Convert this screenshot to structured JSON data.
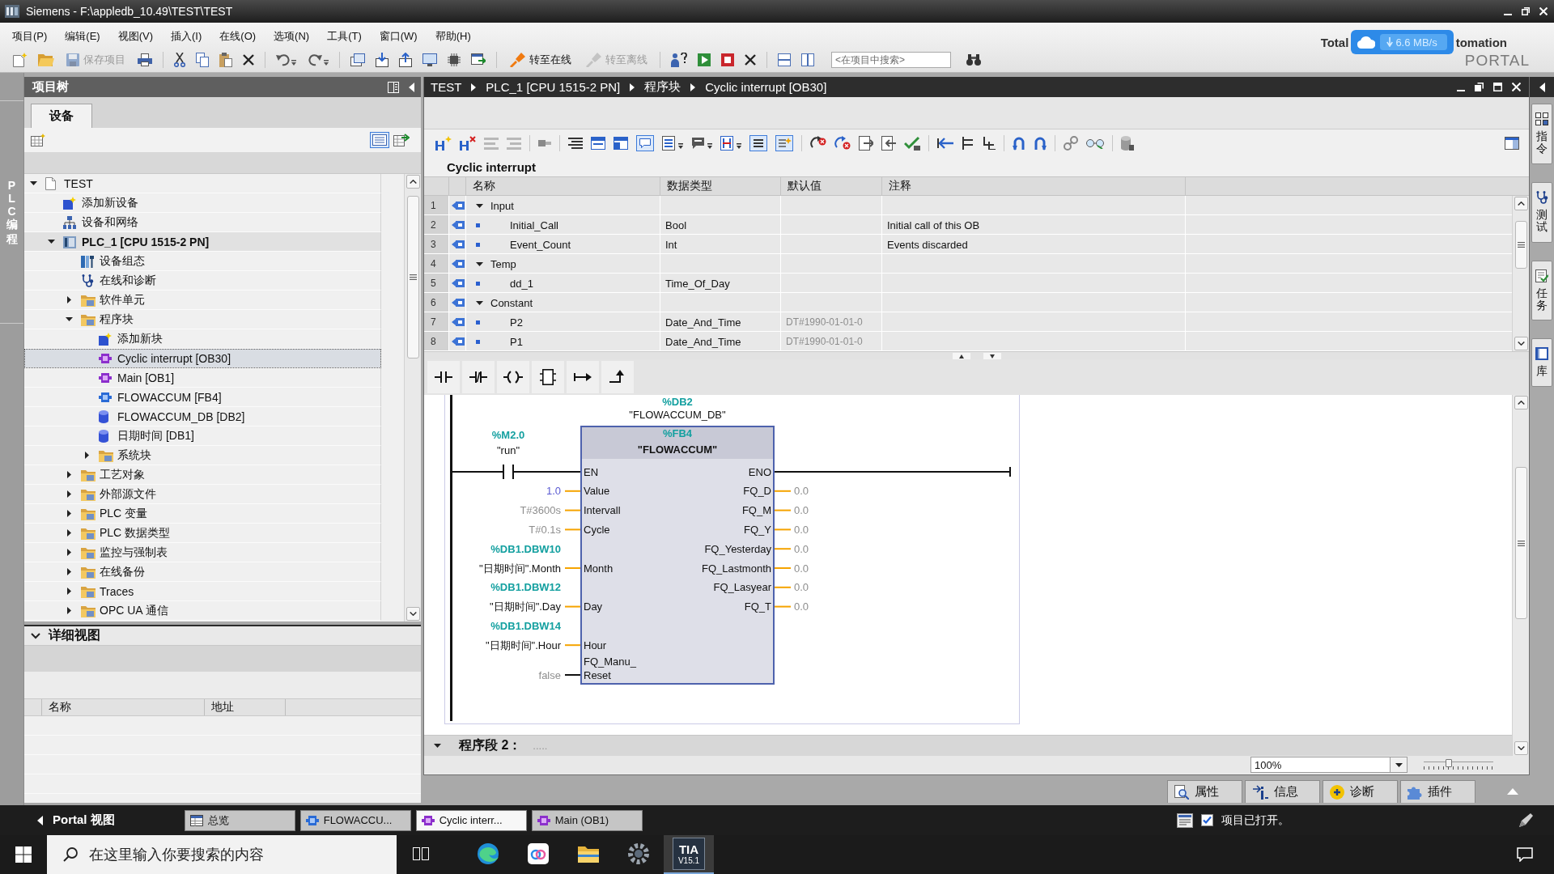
{
  "window": {
    "title": "Siemens - F:\\appledb_10.49\\TEST\\TEST"
  },
  "menu": [
    {
      "label": "项目(P)"
    },
    {
      "label": "编辑(E)"
    },
    {
      "label": "视图(V)"
    },
    {
      "label": "插入(I)"
    },
    {
      "label": "在线(O)"
    },
    {
      "label": "选项(N)"
    },
    {
      "label": "工具(T)"
    },
    {
      "label": "窗口(W)"
    },
    {
      "label": "帮助(H)"
    }
  ],
  "toolbar": {
    "save": {
      "label": "保存项目",
      "disabled": true
    },
    "go_online": {
      "label": "转至在线",
      "disabled": false
    },
    "go_offline": {
      "label": "转至离线",
      "disabled": true
    },
    "search": {
      "placeholder": "<在项目中搜索>"
    }
  },
  "brand": {
    "left": "Total",
    "right": "tomation",
    "product": "PORTAL"
  },
  "download_widget": {
    "reading": "6.6 MB/s"
  },
  "side_strip": {
    "label": "PLC 编程"
  },
  "project_tree": {
    "title": "项目树",
    "tabs": [
      {
        "label": "设备",
        "selected": true
      }
    ],
    "items": [
      {
        "label": "TEST",
        "kind": "project",
        "selected": false,
        "expanded": true,
        "children": [
          {
            "label": "添加新设备",
            "kind": "add",
            "selected": false
          },
          {
            "label": "设备和网络",
            "kind": "network",
            "selected": false
          },
          {
            "label": "PLC_1 [CPU 1515-2 PN]",
            "kind": "plc",
            "selected": false,
            "expanded": true,
            "children": [
              {
                "label": "设备组态",
                "kind": "config",
                "selected": false
              },
              {
                "label": "在线和诊断",
                "kind": "diagnostics",
                "selected": false
              },
              {
                "label": "软件单元",
                "kind": "folder",
                "selected": false,
                "expanded": false
              },
              {
                "label": "程序块",
                "kind": "folder",
                "selected": false,
                "expanded": true,
                "children": [
                  {
                    "label": "添加新块",
                    "kind": "add",
                    "selected": false
                  },
                  {
                    "label": "Cyclic interrupt [OB30]",
                    "kind": "ob",
                    "selected": true
                  },
                  {
                    "label": "Main [OB1]",
                    "kind": "ob",
                    "selected": false
                  },
                  {
                    "label": "FLOWACCUM [FB4]",
                    "kind": "fb",
                    "selected": false
                  },
                  {
                    "label": "FLOWACCUM_DB [DB2]",
                    "kind": "db",
                    "selected": false
                  },
                  {
                    "label": "日期时间 [DB1]",
                    "kind": "db",
                    "selected": false
                  },
                  {
                    "label": "系统块",
                    "kind": "folder",
                    "selected": false,
                    "expanded": false
                  }
                ]
              },
              {
                "label": "工艺对象",
                "kind": "folder",
                "selected": false,
                "expanded": false
              },
              {
                "label": "外部源文件",
                "kind": "folder",
                "selected": false,
                "expanded": false
              },
              {
                "label": "PLC 变量",
                "kind": "folder",
                "selected": false,
                "expanded": false
              },
              {
                "label": "PLC 数据类型",
                "kind": "folder",
                "selected": false,
                "expanded": false
              },
              {
                "label": "监控与强制表",
                "kind": "folder",
                "selected": false,
                "expanded": false
              },
              {
                "label": "在线备份",
                "kind": "folder",
                "selected": false,
                "expanded": false
              },
              {
                "label": "Traces",
                "kind": "folder",
                "selected": false,
                "expanded": false
              },
              {
                "label": "OPC UA 通信",
                "kind": "folder",
                "selected": false,
                "expanded": false
              }
            ]
          }
        ]
      }
    ]
  },
  "details_view": {
    "title": "详细视图",
    "expanded": true,
    "columns": [
      {
        "label": "名称"
      },
      {
        "label": "地址"
      }
    ]
  },
  "editor": {
    "breadcrumb": [
      {
        "label": "TEST"
      },
      {
        "label": "PLC_1 [CPU 1515-2 PN]"
      },
      {
        "label": "程序块"
      },
      {
        "label": "Cyclic interrupt [OB30]"
      }
    ],
    "block_title": "Cyclic interrupt",
    "interface": {
      "columns": [
        {
          "label": "名称"
        },
        {
          "label": "数据类型"
        },
        {
          "label": "默认值"
        },
        {
          "label": "注释"
        }
      ],
      "rows": [
        {
          "number": "1",
          "kind": "section",
          "name": "Input",
          "expanded": true
        },
        {
          "number": "2",
          "kind": "member",
          "name": "Initial_Call",
          "datatype": "Bool",
          "comment": "Initial call of this OB"
        },
        {
          "number": "3",
          "kind": "member",
          "name": "Event_Count",
          "datatype": "Int",
          "comment": "Events discarded"
        },
        {
          "number": "4",
          "kind": "section",
          "name": "Temp",
          "expanded": true
        },
        {
          "number": "5",
          "kind": "member",
          "name": "dd_1",
          "datatype": "Time_Of_Day"
        },
        {
          "number": "6",
          "kind": "section",
          "name": "Constant",
          "expanded": true
        },
        {
          "number": "7",
          "kind": "member",
          "name": "P2",
          "datatype": "Date_And_Time",
          "default": "DT#1990-01-01-0"
        },
        {
          "number": "8",
          "kind": "member",
          "name": "P1",
          "datatype": "Date_And_Time",
          "default": "DT#1990-01-01-0"
        }
      ]
    },
    "network": {
      "instance": {
        "address": "%DB2",
        "name": "\"FLOWACCUM_DB\""
      },
      "block": {
        "address": "%FB4",
        "name": "\"FLOWACCUM\"",
        "en": "EN",
        "eno": "ENO"
      },
      "contact": {
        "address": "%M2.0",
        "name": "\"run\""
      },
      "inputs": [
        {
          "pin": "Value",
          "operand": "1.0",
          "kind": "constant",
          "bool": false
        },
        {
          "pin": "Intervall",
          "operand": "T#3600s",
          "kind": "default",
          "bool": false
        },
        {
          "pin": "Cycle",
          "operand": "T#0.1s",
          "kind": "default",
          "bool": false
        },
        {
          "pin": "Month",
          "address": "%DB1.DBW10",
          "operand": "\"日期时间\".Month",
          "kind": "tag",
          "bool": false
        },
        {
          "pin": "Day",
          "address": "%DB1.DBW12",
          "operand": "\"日期时间\".Day",
          "kind": "tag",
          "bool": false
        },
        {
          "pin": "Hour",
          "address": "%DB1.DBW14",
          "operand": "\"日期时间\".Hour",
          "kind": "tag",
          "bool": false
        },
        {
          "pin": "FQ_Manu_Reset",
          "operand": "false",
          "kind": "default",
          "bool": true
        }
      ],
      "outputs": [
        {
          "pin": "FQ_D",
          "value": "0.0"
        },
        {
          "pin": "FQ_M",
          "value": "0.0"
        },
        {
          "pin": "FQ_Y",
          "value": "0.0"
        },
        {
          "pin": "FQ_Yesterday",
          "value": "0.0"
        },
        {
          "pin": "FQ_Lastmonth",
          "value": "0.0"
        },
        {
          "pin": "FQ_Lasyear",
          "value": "0.0"
        },
        {
          "pin": "FQ_T",
          "value": "0.0"
        }
      ]
    },
    "next_network": {
      "title": "程序段 2：",
      "comment": ".....",
      "expanded": true
    },
    "zoom": {
      "value": "100%",
      "level": 0.35
    }
  },
  "task_cards": [
    {
      "label": "指令",
      "kind": "instructions"
    },
    {
      "label": "测试",
      "kind": "testing"
    },
    {
      "label": "任务",
      "kind": "tasks"
    },
    {
      "label": "库",
      "kind": "libraries"
    }
  ],
  "inspector_tabs": [
    {
      "label": "属性",
      "kind": "properties",
      "selected": false
    },
    {
      "label": "信息",
      "kind": "info",
      "selected": false
    },
    {
      "label": "诊断",
      "kind": "diagnostics",
      "selected": false
    },
    {
      "label": "插件",
      "kind": "addins",
      "selected": false
    }
  ],
  "portal_bar": {
    "portal_view": "Portal 视图",
    "tabs": [
      {
        "label": "总览",
        "kind": "overview",
        "selected": false
      },
      {
        "label": "FLOWACCU...",
        "kind": "fb",
        "selected": false
      },
      {
        "label": "Cyclic interr...",
        "kind": "ob",
        "selected": true
      },
      {
        "label": "Main (OB1)",
        "kind": "ob",
        "selected": false
      }
    ],
    "status": {
      "checked": true,
      "text": "项目已打开。"
    }
  },
  "taskbar": {
    "search": {
      "placeholder": "在这里输入你要搜索的内容"
    },
    "apps": [
      {
        "kind": "task_view",
        "active": false
      },
      {
        "kind": "browser",
        "active": false
      },
      {
        "kind": "cloud",
        "active": false
      },
      {
        "kind": "files",
        "active": false
      },
      {
        "kind": "tool",
        "active": false
      },
      {
        "kind": "tia",
        "active": true,
        "label": "TIA",
        "version": "V15.1"
      }
    ]
  }
}
